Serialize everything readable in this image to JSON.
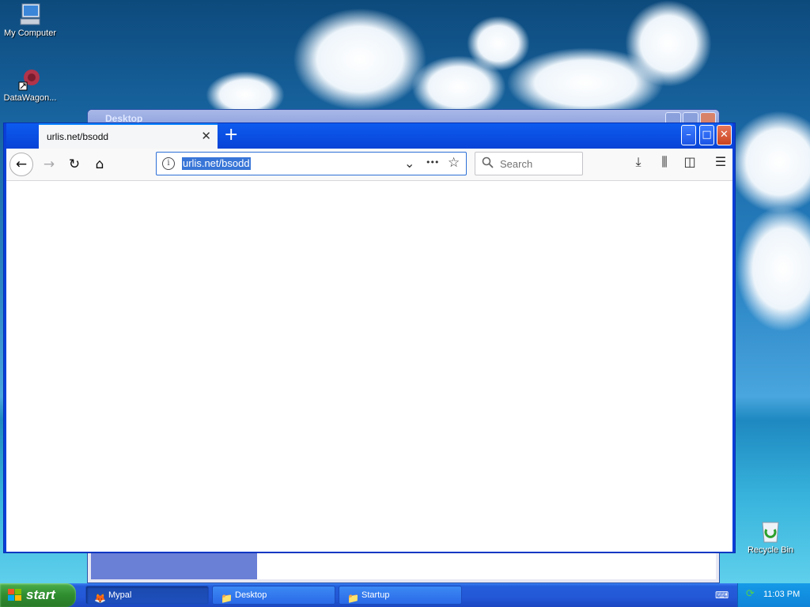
{
  "desktop": {
    "icons": [
      {
        "label": "My Computer"
      },
      {
        "label": "DataWagon..."
      },
      {
        "label": "Recycle Bin"
      }
    ],
    "background_window_title": "Desktop"
  },
  "browser": {
    "tab_title": "urlis.net/bsodd",
    "tab_close": "✕",
    "new_tab": "+",
    "url": "urlis.net/bsodd",
    "info_glyph": "i",
    "search_placeholder": "Search",
    "window_buttons": {
      "minimize": "–",
      "maximize": "□",
      "close": "✕"
    },
    "nav": {
      "back": "←",
      "forward": "→",
      "reload": "↻",
      "home": "⌂"
    },
    "toolbar": {
      "downloads": "⤓",
      "library": "⫼",
      "sidebar": "◫",
      "menu": "☰",
      "dropdown": "⌄",
      "page_actions": "•••",
      "bookmark": "☆"
    }
  },
  "taskbar": {
    "start_label": "start",
    "items": [
      {
        "label": "Mypal",
        "icon": "mypal-icon",
        "active": true
      },
      {
        "label": "Desktop",
        "icon": "folder-icon",
        "active": false
      },
      {
        "label": "Startup",
        "icon": "folder-icon",
        "active": false
      }
    ],
    "clock": "11:03 PM"
  },
  "colors": {
    "titlebar_blue": "#0a3fd8",
    "url_selection": "#3875d7",
    "start_green": "#2f8d2f"
  }
}
